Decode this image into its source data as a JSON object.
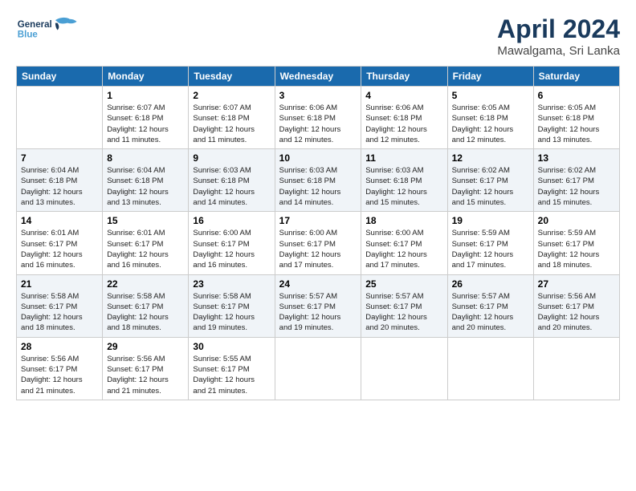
{
  "header": {
    "logo_general": "General",
    "logo_blue": "Blue",
    "month": "April 2024",
    "location": "Mawalgama, Sri Lanka"
  },
  "weekdays": [
    "Sunday",
    "Monday",
    "Tuesday",
    "Wednesday",
    "Thursday",
    "Friday",
    "Saturday"
  ],
  "weeks": [
    [
      {
        "day": "",
        "info": ""
      },
      {
        "day": "1",
        "info": "Sunrise: 6:07 AM\nSunset: 6:18 PM\nDaylight: 12 hours\nand 11 minutes."
      },
      {
        "day": "2",
        "info": "Sunrise: 6:07 AM\nSunset: 6:18 PM\nDaylight: 12 hours\nand 11 minutes."
      },
      {
        "day": "3",
        "info": "Sunrise: 6:06 AM\nSunset: 6:18 PM\nDaylight: 12 hours\nand 12 minutes."
      },
      {
        "day": "4",
        "info": "Sunrise: 6:06 AM\nSunset: 6:18 PM\nDaylight: 12 hours\nand 12 minutes."
      },
      {
        "day": "5",
        "info": "Sunrise: 6:05 AM\nSunset: 6:18 PM\nDaylight: 12 hours\nand 12 minutes."
      },
      {
        "day": "6",
        "info": "Sunrise: 6:05 AM\nSunset: 6:18 PM\nDaylight: 12 hours\nand 13 minutes."
      }
    ],
    [
      {
        "day": "7",
        "info": "Sunrise: 6:04 AM\nSunset: 6:18 PM\nDaylight: 12 hours\nand 13 minutes."
      },
      {
        "day": "8",
        "info": "Sunrise: 6:04 AM\nSunset: 6:18 PM\nDaylight: 12 hours\nand 13 minutes."
      },
      {
        "day": "9",
        "info": "Sunrise: 6:03 AM\nSunset: 6:18 PM\nDaylight: 12 hours\nand 14 minutes."
      },
      {
        "day": "10",
        "info": "Sunrise: 6:03 AM\nSunset: 6:18 PM\nDaylight: 12 hours\nand 14 minutes."
      },
      {
        "day": "11",
        "info": "Sunrise: 6:03 AM\nSunset: 6:18 PM\nDaylight: 12 hours\nand 15 minutes."
      },
      {
        "day": "12",
        "info": "Sunrise: 6:02 AM\nSunset: 6:17 PM\nDaylight: 12 hours\nand 15 minutes."
      },
      {
        "day": "13",
        "info": "Sunrise: 6:02 AM\nSunset: 6:17 PM\nDaylight: 12 hours\nand 15 minutes."
      }
    ],
    [
      {
        "day": "14",
        "info": "Sunrise: 6:01 AM\nSunset: 6:17 PM\nDaylight: 12 hours\nand 16 minutes."
      },
      {
        "day": "15",
        "info": "Sunrise: 6:01 AM\nSunset: 6:17 PM\nDaylight: 12 hours\nand 16 minutes."
      },
      {
        "day": "16",
        "info": "Sunrise: 6:00 AM\nSunset: 6:17 PM\nDaylight: 12 hours\nand 16 minutes."
      },
      {
        "day": "17",
        "info": "Sunrise: 6:00 AM\nSunset: 6:17 PM\nDaylight: 12 hours\nand 17 minutes."
      },
      {
        "day": "18",
        "info": "Sunrise: 6:00 AM\nSunset: 6:17 PM\nDaylight: 12 hours\nand 17 minutes."
      },
      {
        "day": "19",
        "info": "Sunrise: 5:59 AM\nSunset: 6:17 PM\nDaylight: 12 hours\nand 17 minutes."
      },
      {
        "day": "20",
        "info": "Sunrise: 5:59 AM\nSunset: 6:17 PM\nDaylight: 12 hours\nand 18 minutes."
      }
    ],
    [
      {
        "day": "21",
        "info": "Sunrise: 5:58 AM\nSunset: 6:17 PM\nDaylight: 12 hours\nand 18 minutes."
      },
      {
        "day": "22",
        "info": "Sunrise: 5:58 AM\nSunset: 6:17 PM\nDaylight: 12 hours\nand 18 minutes."
      },
      {
        "day": "23",
        "info": "Sunrise: 5:58 AM\nSunset: 6:17 PM\nDaylight: 12 hours\nand 19 minutes."
      },
      {
        "day": "24",
        "info": "Sunrise: 5:57 AM\nSunset: 6:17 PM\nDaylight: 12 hours\nand 19 minutes."
      },
      {
        "day": "25",
        "info": "Sunrise: 5:57 AM\nSunset: 6:17 PM\nDaylight: 12 hours\nand 20 minutes."
      },
      {
        "day": "26",
        "info": "Sunrise: 5:57 AM\nSunset: 6:17 PM\nDaylight: 12 hours\nand 20 minutes."
      },
      {
        "day": "27",
        "info": "Sunrise: 5:56 AM\nSunset: 6:17 PM\nDaylight: 12 hours\nand 20 minutes."
      }
    ],
    [
      {
        "day": "28",
        "info": "Sunrise: 5:56 AM\nSunset: 6:17 PM\nDaylight: 12 hours\nand 21 minutes."
      },
      {
        "day": "29",
        "info": "Sunrise: 5:56 AM\nSunset: 6:17 PM\nDaylight: 12 hours\nand 21 minutes."
      },
      {
        "day": "30",
        "info": "Sunrise: 5:55 AM\nSunset: 6:17 PM\nDaylight: 12 hours\nand 21 minutes."
      },
      {
        "day": "",
        "info": ""
      },
      {
        "day": "",
        "info": ""
      },
      {
        "day": "",
        "info": ""
      },
      {
        "day": "",
        "info": ""
      }
    ]
  ]
}
